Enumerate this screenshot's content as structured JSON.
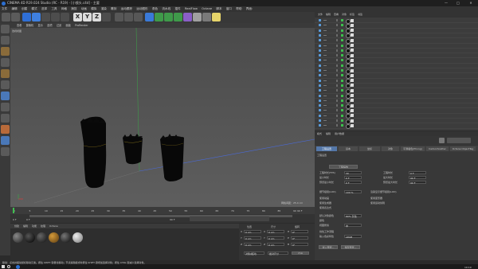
{
  "window": {
    "title": "CINEMA 4D R19.024 Studio (RC - R19) - [小镜头.c4d] - 主要",
    "controls": [
      "—",
      "□",
      "✕"
    ]
  },
  "menubar": [
    "文件",
    "编辑",
    "创建",
    "模式",
    "选择",
    "工具",
    "网格",
    "捕捉",
    "动画",
    "模拟",
    "渲染",
    "雕刻",
    "运动跟踪",
    "运动图形",
    "角色",
    "流水线",
    "插件",
    "RealFlow",
    "Octane",
    "脚本",
    "窗口",
    "帮助",
    "界面:"
  ],
  "toolbar": {
    "axis_labels": [
      "X",
      "Y",
      "Z"
    ]
  },
  "viewport": {
    "menu": [
      "查看",
      "摄像机",
      "显示",
      "选项",
      "过滤",
      "面板",
      "ProRender"
    ],
    "label": "透视视图",
    "grid_text": "网格间距：25.4 cm"
  },
  "timeline": {
    "ticks": [
      "0",
      "5",
      "10",
      "15",
      "20",
      "25",
      "30",
      "35",
      "40",
      "45",
      "50",
      "55",
      "60",
      "65",
      "70",
      "75",
      "80",
      "85",
      "90"
    ],
    "frame_start": "0 F",
    "frame_end": "90 F",
    "current": "0 F",
    "end_field": "90 F"
  },
  "materials": {
    "menu": [
      "创建",
      "编辑",
      "功能",
      "纹理",
      "Octane"
    ]
  },
  "coords": {
    "headers": [
      "位置",
      "尺寸",
      "旋转"
    ],
    "rows": [
      {
        "axis": "X",
        "pos": "0 cm",
        "size": "0 cm",
        "rot_label": "H",
        "rot": "0°"
      },
      {
        "axis": "Y",
        "pos": "0 cm",
        "size": "0 cm",
        "rot_label": "P",
        "rot": "0°"
      },
      {
        "axis": "Z",
        "pos": "0 cm",
        "size": "0 cm",
        "rot_label": "B",
        "rot": "0°"
      }
    ],
    "mode_left": "对象(相对)",
    "mode_right": "绝对尺寸",
    "apply": "应用"
  },
  "object_manager": {
    "menu": [
      "文件",
      "编辑",
      "查看",
      "对象",
      "标签",
      "书签"
    ],
    "row_count": 22
  },
  "attributes": {
    "menu": [
      "模式",
      "编辑",
      "用户数据"
    ],
    "tabs": [
      "基本",
      "坐标",
      "对象",
      "平滑着色(Phong)",
      "CarbonScatter",
      "Octane ObjectTag",
      "绑定"
    ],
    "active_tab": "工程设置",
    "section": "工程设置",
    "scene_button": "工程缩放",
    "row1_left_label": "工程时长(FPS)",
    "row1_left_value": "30",
    "row1_right_label": "工程时长",
    "row1_right_value": "0 F",
    "row2_left_label": "最小时长",
    "row2_left_value": "0 F",
    "row2_right_label": "最大时长",
    "row2_right_value": "90 F",
    "row3_left_label": "预览最小时长",
    "row3_left_value": "0 F",
    "row3_right_label": "预览最大时长",
    "row3_right_value": "90 F",
    "lod_label": "细节级别(LOD)",
    "lod_value": "100 %",
    "lod_check": "渲染显示细节级别(LOD)",
    "checks_left": [
      "使用动画",
      "使用生成器",
      "使用表达式"
    ],
    "checks_right": [
      "使用变形器",
      "使用运动剪辑"
    ],
    "color_label": "默认对象颜色",
    "color_value": "80% 灰色",
    "color2_label": "颜色",
    "linear_label": "视图修剪",
    "linear_value": "中",
    "linear_workflow": "线性工作流程",
    "input_color_label": "输入色彩特性",
    "input_color_value": "sRGB",
    "btn_load": "载入预置...",
    "btn_save": "保存预置..."
  },
  "statusbar": {
    "text": "移动：点击并拖动鼠标移动元素。按住 SHIFT 键量化移动；节点编辑模式时按住 SHIFT 键增加选择对象；按住 CTRL 键减少选择对象。"
  },
  "taskbar": {
    "time": "10:19"
  },
  "colors": {
    "viewport_top": "#4b4b4b",
    "viewport_bottom": "#5e5e5e",
    "accent_blue": "#4a7dc4",
    "active_tab": "#5477a8"
  }
}
